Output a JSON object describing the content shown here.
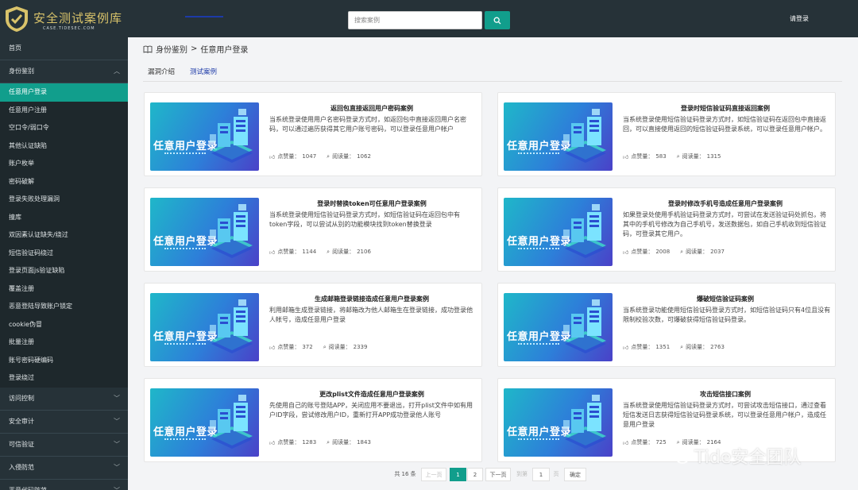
{
  "header": {
    "logo_title": "安全测试案例库",
    "logo_sub": "CASE.TIDESEC.COM",
    "search_placeholder": "搜索案例",
    "login": "请登录"
  },
  "sidebar": {
    "items": [
      {
        "label": "首页",
        "kind": "top"
      },
      {
        "label": "身份鉴别",
        "kind": "group-open"
      },
      {
        "label": "任意用户登录",
        "kind": "active"
      },
      {
        "label": "任意用户注册",
        "kind": "sub"
      },
      {
        "label": "空口令/弱口令",
        "kind": "sub"
      },
      {
        "label": "其他认证缺陷",
        "kind": "sub"
      },
      {
        "label": "账户枚举",
        "kind": "sub"
      },
      {
        "label": "密码破解",
        "kind": "sub"
      },
      {
        "label": "登录失败处理漏洞",
        "kind": "sub"
      },
      {
        "label": "撞库",
        "kind": "sub"
      },
      {
        "label": "双因素认证缺失/绕过",
        "kind": "sub"
      },
      {
        "label": "短信验证码绕过",
        "kind": "sub"
      },
      {
        "label": "登录页面js验证缺陷",
        "kind": "sub"
      },
      {
        "label": "覆盖注册",
        "kind": "sub"
      },
      {
        "label": "恶意登陆导致账户锁定",
        "kind": "sub"
      },
      {
        "label": "cookie伪冒",
        "kind": "sub"
      },
      {
        "label": "批量注册",
        "kind": "sub"
      },
      {
        "label": "账号密码硬编码",
        "kind": "sub"
      },
      {
        "label": "登录绕过",
        "kind": "sub"
      },
      {
        "label": "访问控制",
        "kind": "group"
      },
      {
        "label": "安全审计",
        "kind": "group"
      },
      {
        "label": "可信验证",
        "kind": "group"
      },
      {
        "label": "入侵防范",
        "kind": "group"
      },
      {
        "label": "恶意代码防范",
        "kind": "group"
      }
    ]
  },
  "breadcrumb": {
    "section": "身份鉴别",
    "sep": ">",
    "current": "任意用户登录"
  },
  "tabs": [
    {
      "label": "漏洞介绍",
      "active": false
    },
    {
      "label": "测试案例",
      "active": true
    }
  ],
  "thumb_text": "任意用户登录",
  "likes_label": "点赞量：",
  "reads_label": "阅读量：",
  "cards": [
    {
      "title": "返回包直接返回用户密码案例",
      "desc": "当系统登录使用用户名密码登录方式时，如返回包中直接返回用户名密码，可以通过遍历获得其它用户账号密码，可以登录任意用户帐户",
      "likes": "1047",
      "reads": "1062"
    },
    {
      "title": "登录时短信验证码直接返回案例",
      "desc": "当系统登录使用短信验证码登录方式时，如短信验证码在返回包中直接返回，可以直接使用返回的短信验证码登录系统，可以登录任意用户帐户。",
      "likes": "583",
      "reads": "1315"
    },
    {
      "title": "登录时替换token可任意用户登录案例",
      "desc": "当系统登录使用短信验证码登录方式时，如短信验证码在返回包中有token字段，可以尝试从别的功能模块找到token替换登录",
      "likes": "1144",
      "reads": "2106"
    },
    {
      "title": "登录时修改手机号造成任意用户登录案例",
      "desc": "如果登录处使用手机验证码登录方式时，可尝试在发送验证码处抓包，将其中的手机号修改为自己手机号，发送数据包，如自己手机收到短信验证码，可登录其它用户。",
      "likes": "2008",
      "reads": "2037"
    },
    {
      "title": "生成邮箱登录链接造成任意用户登录案例",
      "desc": "利用邮箱生成登录链接，将邮箱改为他人邮箱生在登录链接，成功登录他人帐号，造成任意用户登录",
      "likes": "372",
      "reads": "2339"
    },
    {
      "title": "爆破短信验证码案例",
      "desc": "当系统登录功能使用短信验证码登录方式时，如短信验证码只有4位且没有限制校验次数，可爆破获得短信验证码登录。",
      "likes": "1351",
      "reads": "2763"
    },
    {
      "title": "更改plist文件造成任意用户登录案例",
      "desc": "先使用自己的账号登陆APP，关闭应用不要退出，打开plist文件中如有用户ID字段，尝试修改用户ID，重新打开APP成功登录他人账号",
      "likes": "1283",
      "reads": "1843"
    },
    {
      "title": "攻击短信接口案例",
      "desc": "当系统登录使用短信验证码登录方式时，可尝试攻击短信接口，通过查看短信发送日志获得短信验证码登录系统，可以登录任意用户帐户，造成任意用户登录",
      "likes": "725",
      "reads": "2164"
    }
  ],
  "pagination": {
    "total": "共 16 条",
    "prev": "上一页",
    "pages": [
      "1",
      "2"
    ],
    "current": "1",
    "next": "下一页",
    "goto_label": "到第",
    "goto_value": "1",
    "page_suffix": "页",
    "confirm": "确定"
  },
  "watermark": "Tide安全团队",
  "colors": {
    "header_bg": "#263238",
    "accent": "#119e8c",
    "tab_active": "#1d3aa8"
  }
}
